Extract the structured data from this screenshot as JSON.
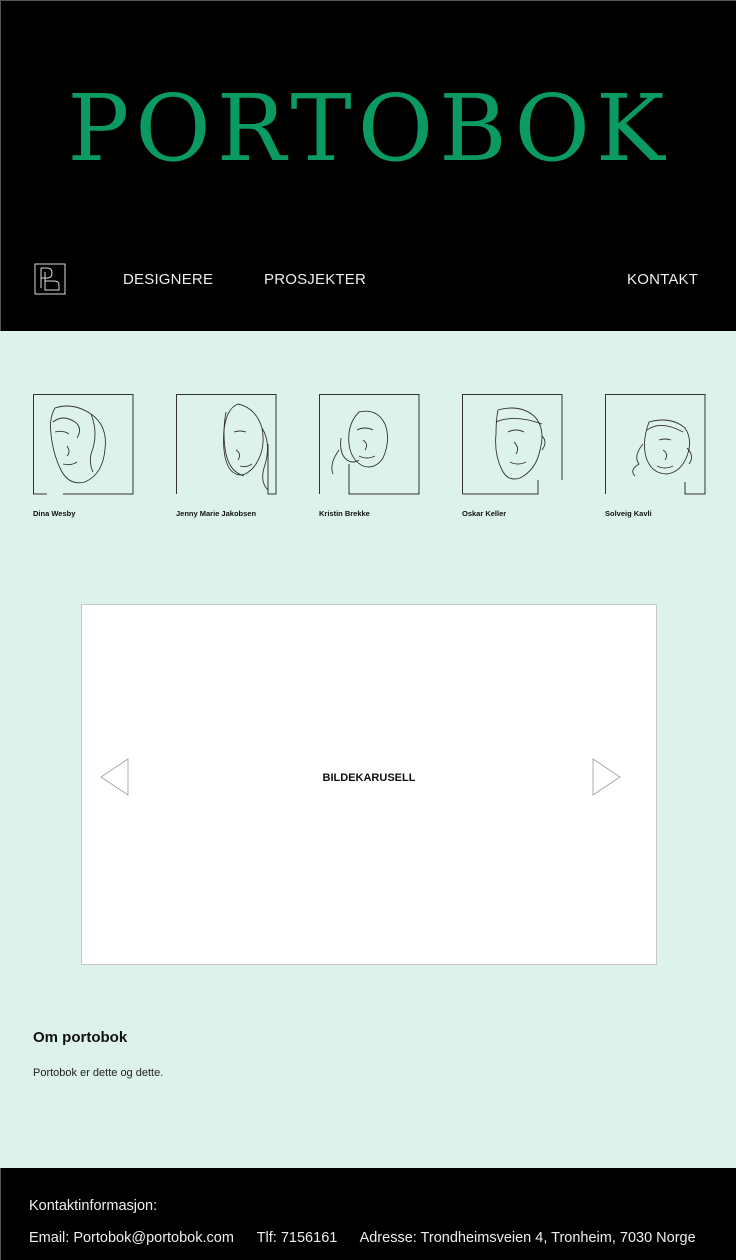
{
  "header": {
    "title": "PORTOBOK",
    "logo_icon": "pb-monogram-icon",
    "nav": {
      "designere": "DESIGNERE",
      "prosjekter": "PROSJEKTER",
      "kontakt": "KONTAKT"
    }
  },
  "designers": [
    {
      "name": "Dina Wesby",
      "icon": "line-art-portrait-icon"
    },
    {
      "name": "Jenny Marie Jakobsen",
      "icon": "line-art-portrait-icon"
    },
    {
      "name": "Kristin Brekke",
      "icon": "line-art-portrait-icon"
    },
    {
      "name": "Oskar Keller",
      "icon": "line-art-portrait-icon"
    },
    {
      "name": "Solveig Kavli",
      "icon": "line-art-portrait-icon"
    }
  ],
  "carousel": {
    "label": "BILDEKARUSELL",
    "prev_icon": "triangle-left-icon",
    "next_icon": "triangle-right-icon"
  },
  "about": {
    "title": "Om portobok",
    "text": "Portobok er dette og dette."
  },
  "footer": {
    "title": "Kontaktinformasjon:",
    "email": "Email: Portobok@portobok.com",
    "phone": "Tlf: 7156161",
    "address": "Adresse: Trondheimsveien 4, Tronheim, 7030 Norge"
  },
  "colors": {
    "brand_green": "#0a9a62",
    "background": "#ddf2ea",
    "header_bg": "#000000"
  }
}
